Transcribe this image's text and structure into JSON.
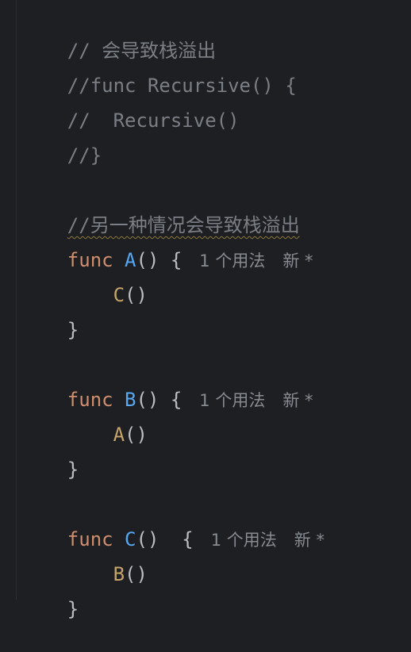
{
  "code": {
    "line1": "// 会导致栈溢出",
    "line2": "//func Recursive() {",
    "line3": "//  Recursive()",
    "line4": "//}",
    "line6": "//另一种情况会导致栈溢出",
    "func_kw": "func",
    "fn_a": "A",
    "fn_b": "B",
    "fn_c": "C",
    "parens_open": "() {",
    "parens_open_c": "()  {",
    "call_a": "A",
    "call_b": "B",
    "call_c": "C",
    "call_parens": "()",
    "close_brace": "}",
    "indent": "    "
  },
  "hints": {
    "usages": "1 个用法",
    "new_marker": "新 *"
  }
}
